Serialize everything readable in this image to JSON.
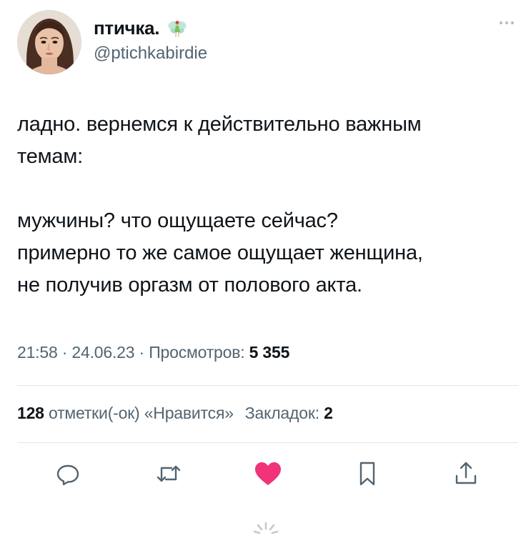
{
  "author": {
    "display_name": "птичка.",
    "handle": "@ptichkabirdie",
    "badge_icon": "fairy-icon"
  },
  "tweet": {
    "text": "ладно. вернемся к действительно важным\nтемам:\n\nмужчины? что ощущаете сейчас?\nпримерно то же самое ощущает женщина,\nне получив оргазм от полового акта."
  },
  "meta": {
    "time": "21:58",
    "date": "24.06.23",
    "views_label": "Просмотров:",
    "views_count": "5 355",
    "separator": " · "
  },
  "stats": {
    "likes_count": "128",
    "likes_label": "отметки(-ок) «Нравится»",
    "bookmarks_label": "Закладок:",
    "bookmarks_count": "2"
  },
  "actions": [
    {
      "name": "reply-icon"
    },
    {
      "name": "retweet-icon"
    },
    {
      "name": "like-icon",
      "color": "#f0337a"
    },
    {
      "name": "bookmark-icon"
    },
    {
      "name": "share-icon"
    }
  ],
  "colors": {
    "text": "#0f1419",
    "secondary": "#536471",
    "like": "#f0337a",
    "divider": "#e1e6ea"
  }
}
